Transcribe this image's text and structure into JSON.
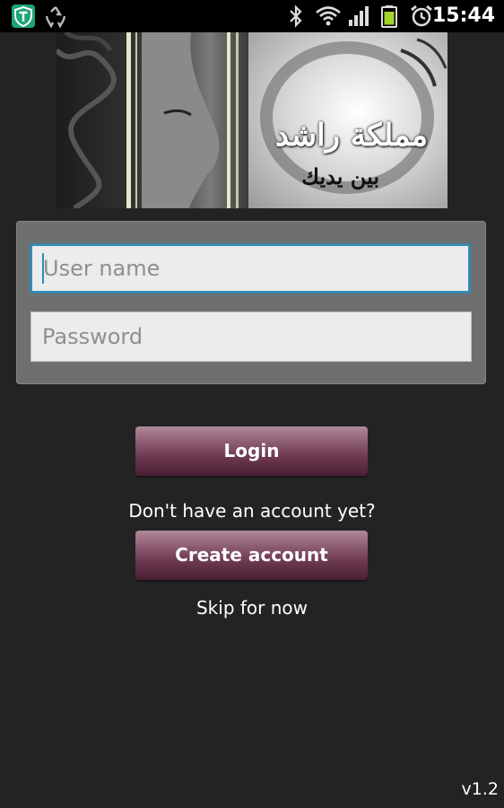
{
  "status_bar": {
    "time": "15:44",
    "icons": [
      "shield-t-icon",
      "recycle-icon",
      "bluetooth-icon",
      "wifi-icon",
      "signal-icon",
      "battery-icon",
      "alarm-icon"
    ]
  },
  "banner": {
    "title_ar": "مملكة راشد",
    "subtitle_ar": "بين يديك"
  },
  "login": {
    "username_placeholder": "User name",
    "password_placeholder": "Password",
    "login_label": "Login"
  },
  "signup": {
    "prompt": "Don't have an account yet?",
    "create_label": "Create account",
    "skip_label": "Skip for now"
  },
  "footer": {
    "version": "v1.2"
  },
  "colors": {
    "background": "#232323",
    "panel": "#6f6f6f",
    "button": "#6e3a52",
    "focus": "#2a8ec0"
  }
}
